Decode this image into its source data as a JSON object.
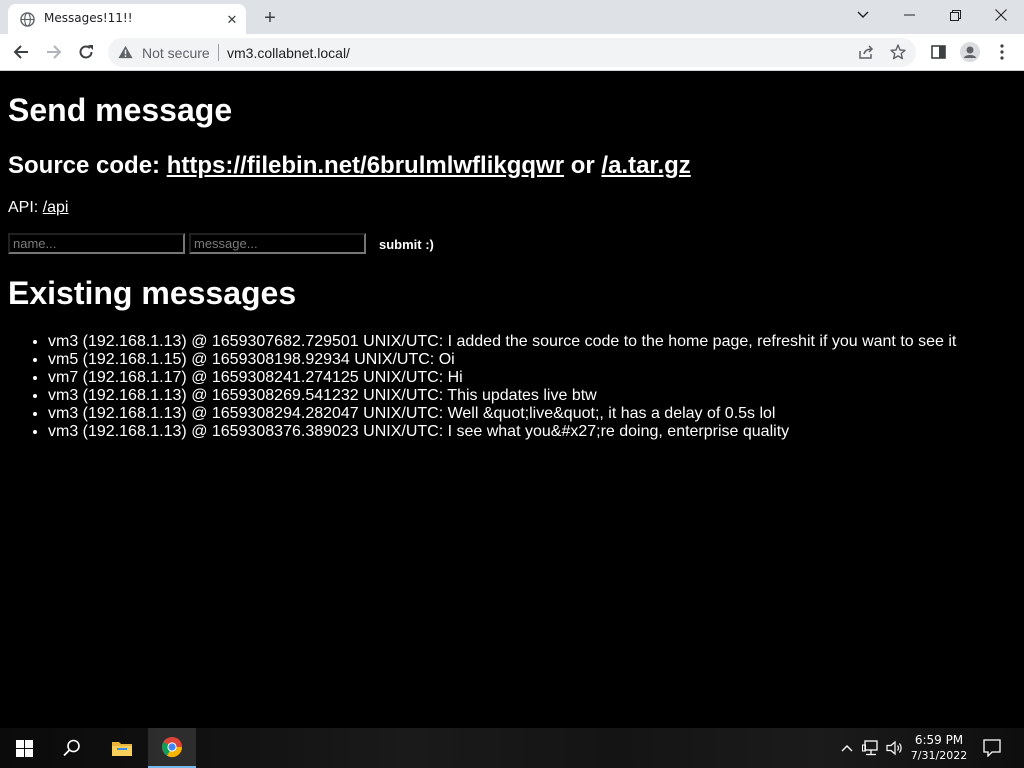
{
  "browser": {
    "tab_title": "Messages!11!!",
    "security_label": "Not secure",
    "url": "vm3.collabnet.local/"
  },
  "page": {
    "heading_send": "Send message",
    "source_prefix": "Source code: ",
    "source_link": "https://filebin.net/6brulmlwflikgqwr",
    "source_or": " or ",
    "archive_link": "/a.tar.gz",
    "api_prefix": "API: ",
    "api_link": "/api",
    "name_placeholder": "name...",
    "message_placeholder": "message...",
    "submit_label": "submit :)",
    "heading_existing": "Existing messages",
    "messages": [
      "vm3 (192.168.1.13) @ 1659307682.729501 UNIX/UTC: I added the source code to the home page, refreshit if you want to see it",
      "vm5 (192.168.1.15) @ 1659308198.92934 UNIX/UTC: Oi",
      "vm7 (192.168.1.17) @ 1659308241.274125 UNIX/UTC: Hi",
      "vm3 (192.168.1.13) @ 1659308269.541232 UNIX/UTC: This updates live btw",
      "vm3 (192.168.1.13) @ 1659308294.282047 UNIX/UTC: Well &quot;live&quot;, it has a delay of 0.5s lol",
      "vm3 (192.168.1.13) @ 1659308376.389023 UNIX/UTC: I see what you&#x27;re doing, enterprise quality"
    ]
  },
  "taskbar": {
    "time": "6:59 PM",
    "date": "7/31/2022",
    "pinned": [
      "start-icon",
      "search-icon",
      "file-explorer-icon",
      "chrome-icon"
    ]
  },
  "colors": {
    "page_bg": "#000000",
    "page_text": "#ffffff",
    "tabstrip_bg": "#dee1e6",
    "taskbar_accent": "#76b9ed"
  }
}
